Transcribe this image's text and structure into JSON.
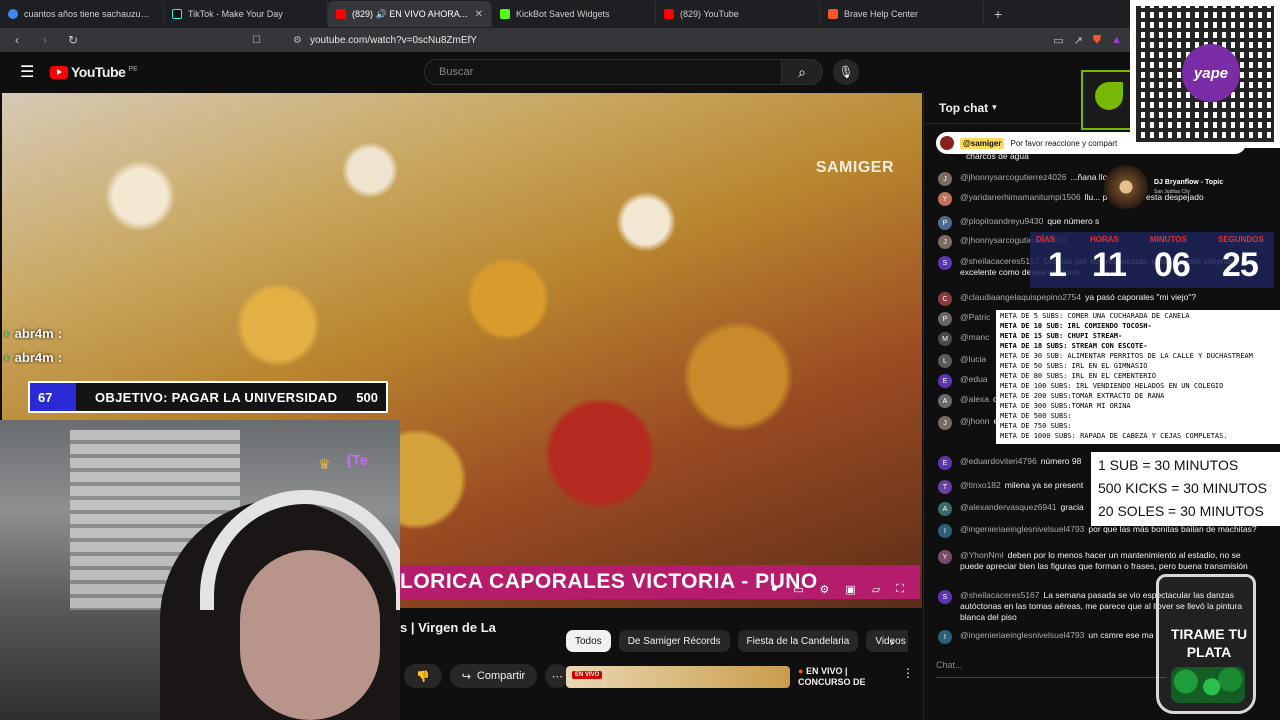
{
  "browser": {
    "tabs": [
      {
        "title": "cuantos años tiene sachauzumaki - B",
        "color": "#4285f4"
      },
      {
        "title": "TikTok - Make Your Day",
        "color": "#111111"
      },
      {
        "title": "(829) 🔊 EN VIVO AHORA - I",
        "color": "#ff0000"
      },
      {
        "title": "KickBot Saved Widgets",
        "color": "#53fc18"
      },
      {
        "title": "(829) YouTube",
        "color": "#ff0000"
      },
      {
        "title": "Brave Help Center",
        "color": "#fb542b"
      }
    ],
    "new_tab": "+",
    "url": "youtube.com/watch?v=0scNu8ZmEfY"
  },
  "youtube": {
    "logo_text": "YouTube",
    "country": "PE",
    "search_placeholder": "Buscar"
  },
  "video": {
    "watermark": "SAMIGER",
    "banner": "LORICA CAPORALES VICTORIA - PUNO",
    "progress": 0.99,
    "chat_overlay": [
      {
        "user": "abr4m"
      },
      {
        "user": "abr4m"
      }
    ],
    "goal": {
      "current": "67",
      "label": "OBJETIVO: PAGAR LA UNIVERSIDAD",
      "target": "500"
    },
    "webcam_badge": "{Te"
  },
  "below": {
    "title": "s | Virgen de La",
    "share": "Compartir",
    "chips": [
      "Todos",
      "De Samiger Récords",
      "Fiesta de la Candelaria",
      "Videos"
    ],
    "rec_badge": "EN VIVO",
    "rec_title": "EN VIVO | CONCURSO DE"
  },
  "chat": {
    "header": "Top chat",
    "pinned_user": "@samiger",
    "pinned_text": "Por favor reaccione y compart",
    "pinned_cont": "charcos de agua",
    "messages": [
      {
        "user": "@jhonnysarcogutierrez4026",
        "text": "...ñana llovió",
        "color": "#7b6a62"
      },
      {
        "user": "@yaridanerhimamanitumpi1506",
        "text": "llu... pero ahora esta despejado",
        "color": "#c0725a"
      },
      {
        "user": "@plopitoandreyu9430",
        "text": "que número s",
        "color": "#4b6b8a"
      },
      {
        "user": "@jhonnysarcogutierrez4026",
        "text": "",
        "color": "#7b6a62"
      },
      {
        "user": "@sheilacaceres5167",
        "text": "Gracias por sus respuestas, ojalá les este saliendo excelente como desea en Puno",
        "color": "#5e35b1"
      },
      {
        "user": "@claudiaangelaquispepino2754",
        "text": "ya pasó caporales \"mi viejo\"?",
        "color": "#8a3a3a"
      },
      {
        "user": "@Patric",
        "text": "",
        "color": "#666666"
      },
      {
        "user": "@manc",
        "text": "",
        "color": "#4a4a4a"
      },
      {
        "user": "@lucia",
        "text": "",
        "color": "#5a5a5a"
      },
      {
        "user": "@edua",
        "text": "",
        "color": "#5e35b1"
      },
      {
        "user": "@alexa",
        "text": "o mien",
        "color": "#6a6a6a"
      },
      {
        "user": "@jhonn",
        "text": "exhibic",
        "color": "#7b6a62"
      },
      {
        "user": "@eduardoviteri4796",
        "text": "número 98",
        "color": "#5e35b1"
      },
      {
        "user": "@tinxo182",
        "text": "milena ya se present",
        "color": "#6b3fa0"
      },
      {
        "user": "@alexandervasquez6941",
        "text": "gracia",
        "color": "#3a6a6a"
      },
      {
        "user": "@ingenieriaeinglesnivelsuel4793",
        "text": "por que las más bonitas bailan de machitas?",
        "color": "#2b5f7a"
      },
      {
        "user": "@YhonNml",
        "text": "deben por lo menos hacer un mantenimiento al estadio, no se puede apreciar bien las figuras que forman o frases, pero buena transmisión",
        "color": "#7a4a6a"
      },
      {
        "user": "@sheilacaceres5167",
        "text": "La semana pasada se vio espectacular las danzas autóctonas en las tomas aéreas, me parece que al llover se llevó la pintura blanca del piso",
        "color": "#5e35b1"
      },
      {
        "user": "@ingenieriaeinglesnivelsuel4793",
        "text": "un csmre ese ma",
        "color": "#2b5f7a"
      }
    ],
    "input_placeholder": "Chat..."
  },
  "widgets": {
    "qr_brand": "yape",
    "music_title": "DJ Bryanflow - Topic",
    "music_sub": "San Juditas City",
    "timer": {
      "labels": [
        "DÍAS",
        "HORAS",
        "MINUTOS",
        "SEGUNDOS"
      ],
      "values": [
        "1",
        "11",
        "06",
        "25"
      ]
    },
    "metas": [
      "META DE 5 SUBS: COMER UNA CUCHARADA DE CANELA",
      "META DE 10 SUB: IRL COMIENDO TOCOSH-",
      "META DE 15 SUB: CHUPI STREAM-",
      "META DE 18 SUBS: STREAM CON ESCOTE-",
      "META DE 30 SUB:  ALIMENTAR PERRITOS DE LA CALLE Y DUCHASTREAM",
      "META DE 50 SUBS: IRL EN EL GIMNASIO",
      "META DE 80 SUBS: IRL EN EL CEMENTERIO",
      "META DE 100 SUBS: IRL VENDIENDO HELADOS EN UN COLEGIO",
      "META DE 200 SUBS:TOMAR EXTRACTO DE RANA",
      "META DE 300 SUBS:TOMAR MI ORINA",
      "META DE 500 SUBS:",
      "META DE 750 SUBS:",
      "META DE 1000 SUBS: RAPADA DE CABEZA Y CEJAS COMPLETAS."
    ],
    "rates": [
      "1 SUB = 30 MINUTOS",
      "500 KICKS = 30 MINUTOS",
      "20 SOLES = 30 MINUTOS"
    ],
    "jar_text": "TIRAME TU PLATA"
  }
}
